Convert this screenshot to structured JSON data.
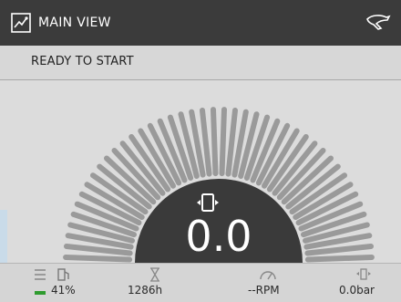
{
  "header": {
    "title": "MAIN VIEW"
  },
  "status": {
    "text": "READY TO START"
  },
  "gauge": {
    "readout": "0.0"
  },
  "footer": {
    "fuel": {
      "value": "41%",
      "level": 0.41
    },
    "hours": {
      "value": "1286h"
    },
    "rpm": {
      "value": "--RPM"
    },
    "pressure": {
      "value": "0.0bar"
    }
  },
  "colors": {
    "title_bar": "#3b3b3b",
    "gauge_dark": "#3a3a3a",
    "gauge_ticks": "#9a9a9a",
    "fuel_accent": "#2e9b2e"
  }
}
